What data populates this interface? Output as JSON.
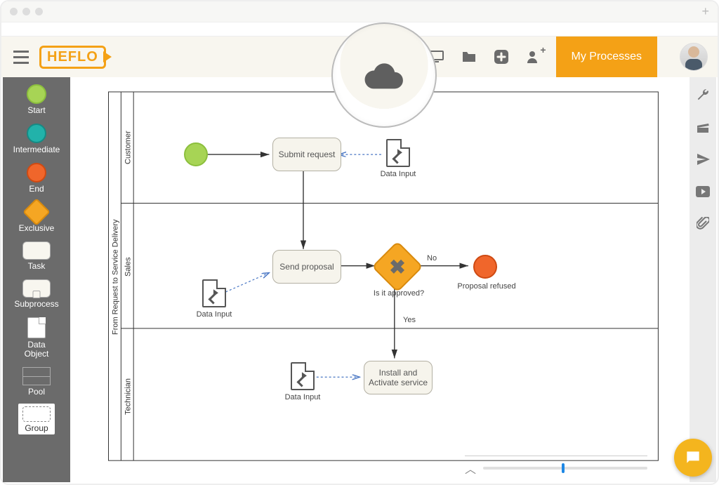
{
  "app": {
    "name": "HEFLO"
  },
  "header": {
    "my_processes_label": "My Processes"
  },
  "palette": {
    "start": "Start",
    "intermediate": "Intermediate",
    "end": "End",
    "exclusive": "Exclusive",
    "task": "Task",
    "subprocess": "Subprocess",
    "data_object": "Data\nObject",
    "pool": "Pool",
    "group": "Group"
  },
  "diagram": {
    "pool_title": "From Request to Service Delivery",
    "lanes": [
      "Customer",
      "Sales",
      "Technician"
    ],
    "nodes": {
      "submit_request": "Submit request",
      "send_proposal": "Send proposal",
      "install_activate": "Install and\nActivate service",
      "gateway_label": "Is it approved?",
      "gateway_no": "No",
      "gateway_yes": "Yes",
      "proposal_refused": "Proposal refused",
      "data_input": "Data Input"
    }
  },
  "colors": {
    "accent": "#f4a116",
    "start": "#a7d455",
    "intermediate": "#22b2aa",
    "end": "#f0662b",
    "gateway": "#f5a623",
    "task_bg": "#f6f4ec"
  }
}
